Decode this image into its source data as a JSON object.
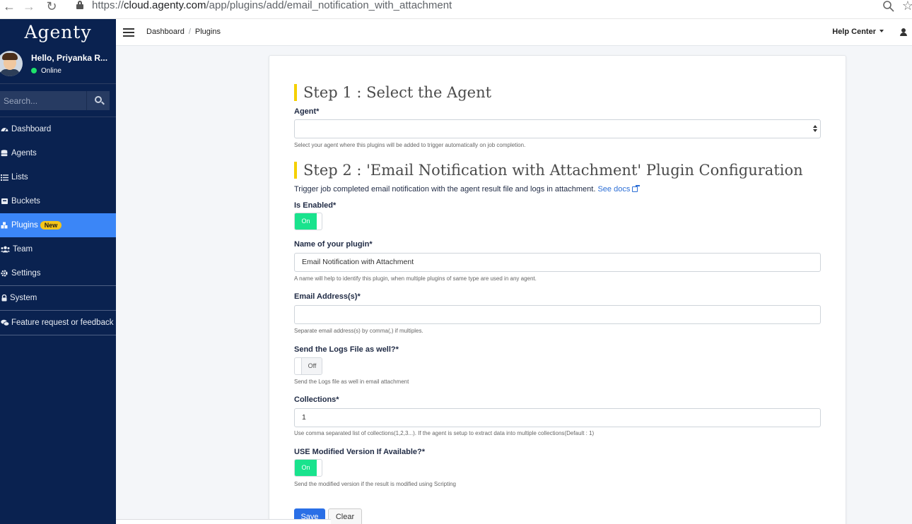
{
  "browser": {
    "url_scheme": "https://",
    "url_host": "cloud.agenty.com",
    "url_path": "/app/plugins/add/email_notification_with_attachment",
    "back_glyph": "←",
    "forward_glyph": "→",
    "reload_glyph": "↻",
    "star_glyph": "☆"
  },
  "sidebar": {
    "logo": "Agenty",
    "user_name": "Hello, Priyanka R...",
    "status": "Online",
    "search_placeholder": "Search...",
    "items": [
      {
        "label": "Dashboard",
        "icon": "tachometer-icon"
      },
      {
        "label": "Agents",
        "icon": "database-icon"
      },
      {
        "label": "Lists",
        "icon": "list-icon"
      },
      {
        "label": "Buckets",
        "icon": "bucket-icon"
      },
      {
        "label": "Plugins",
        "icon": "plugins-icon",
        "badge": "New",
        "active": true
      },
      {
        "label": "Team",
        "icon": "users-icon"
      },
      {
        "label": "Settings",
        "icon": "gear-icon"
      },
      {
        "label": "System",
        "icon": "lock-icon"
      },
      {
        "label": "Feature request or feedback",
        "icon": "comments-icon"
      }
    ]
  },
  "topnav": {
    "breadcrumb": [
      "Dashboard",
      "Plugins"
    ],
    "help_center": "Help Center"
  },
  "form": {
    "step1_title": "Step 1 : Select the Agent",
    "agent_label": "Agent*",
    "agent_value": "",
    "agent_hint": "Select your agent where this plugins will be added to trigger automatically on job completion.",
    "step2_title": "Step 2 : 'Email Notification with Attachment' Plugin Configuration",
    "step2_desc": "Trigger job completed email notification with the agent result file and logs in attachment.",
    "see_docs": "See docs",
    "is_enabled_label": "Is Enabled*",
    "is_enabled_state": "On",
    "name_label": "Name of your plugin*",
    "name_value": "Email Notification with Attachment",
    "name_hint": "A name will help to identify this plugin, when multiple plugins of same type are used in any agent.",
    "email_label": "Email Address(s)*",
    "email_value": "",
    "email_hint": "Separate email address(s) by comma(,) if multiples.",
    "logs_label": "Send the Logs File as well?*",
    "logs_state": "Off",
    "logs_hint": "Send the Logs file as well in email attachment",
    "collections_label": "Collections*",
    "collections_value": "1",
    "collections_hint": "Use comma separated list of collections(1,2,3...). If the agent is setup to extract data into multiple collections(Default : 1)",
    "modified_label": "USE Modified Version If Available?*",
    "modified_state": "On",
    "modified_hint": "Send the modified version if the result is modified using Scripting",
    "save_label": "Save",
    "clear_label": "Clear"
  }
}
